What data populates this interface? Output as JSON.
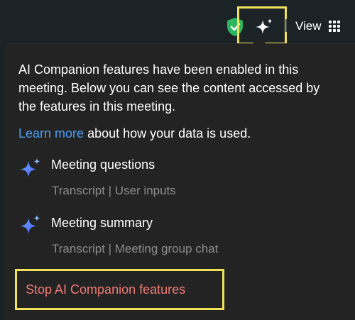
{
  "toolbar": {
    "shield_icon": "shield-check-icon",
    "ai_companion_icon": "sparkle-icon",
    "view_label": "View",
    "view_icon": "grid-icon",
    "highlight_color": "#f2e15b"
  },
  "popup": {
    "description": "AI Companion features have been enabled in this meeting. Below you can see the content accessed by the features in this meeting.",
    "learn_more_link": "Learn more",
    "learn_more_suffix": " about how your data is used.",
    "features": [
      {
        "icon": "ai-sparkle-icon",
        "title": "Meeting questions",
        "sources": "Transcript | User inputs"
      },
      {
        "icon": "ai-sparkle-icon",
        "title": "Meeting summary",
        "sources": "Transcript | Meeting group chat"
      }
    ],
    "stop_button_label": "Stop AI Companion features",
    "link_color": "#4f9ef5",
    "danger_color": "#f07a73"
  }
}
